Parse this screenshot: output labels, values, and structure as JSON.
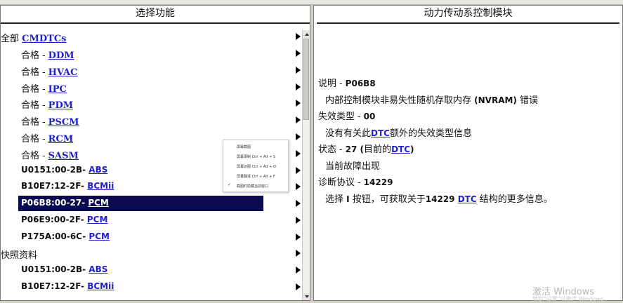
{
  "left_panel": {
    "title": "选择功能",
    "rows": [
      {
        "prefix": "全部 ",
        "link": "CMDTCs",
        "bold": false
      },
      {
        "prefix": "合格 - ",
        "link": "DDM",
        "bold": false
      },
      {
        "prefix": "合格 - ",
        "link": "HVAC",
        "bold": false
      },
      {
        "prefix": "合格 - ",
        "link": "IPC",
        "bold": false
      },
      {
        "prefix": "合格 - ",
        "link": "PDM",
        "bold": false
      },
      {
        "prefix": "合格 - ",
        "link": "PSCM",
        "bold": false
      },
      {
        "prefix": "合格 - ",
        "link": "RCM",
        "bold": false
      },
      {
        "prefix": "合格 - ",
        "link": "SASM",
        "bold": false
      },
      {
        "prefix": "U0151:00-2B- ",
        "link": "ABS",
        "bold": true
      },
      {
        "prefix": "B10E7:12-2F- ",
        "link": "BCMii",
        "bold": true
      },
      {
        "prefix": "P06B8:00-27- ",
        "link": "PCM",
        "bold": true,
        "selected": true
      },
      {
        "prefix": "P06E9:00-2F- ",
        "link": "PCM",
        "bold": true
      },
      {
        "prefix": "P175A:00-6C- ",
        "link": "PCM",
        "bold": true
      },
      {
        "prefix": "快照资料",
        "link": "",
        "bold": false
      },
      {
        "prefix": "U0151:00-2B- ",
        "link": "ABS",
        "bold": true
      },
      {
        "prefix": "B10E7:12-2F- ",
        "link": "BCMii",
        "bold": true
      }
    ]
  },
  "right_panel": {
    "title": "动力传动系控制模块",
    "lines": {
      "l1": {
        "a": "说明 - ",
        "b": "P06B8"
      },
      "l2": {
        "a": "内部控制模块非易失性随机存取内存 ",
        "b": "(NVRAM)",
        "c": " 错误"
      },
      "l3": {
        "a": "失效类型 - ",
        "b": "00"
      },
      "l4": {
        "a": "没有有关此",
        "link": "DTC",
        "c": "额外的失效类型信息"
      },
      "l5": {
        "a": "状态 - ",
        "b": "27 (",
        "c": "目前的",
        "link": "DTC",
        "d": ")"
      },
      "l6": {
        "a": "当前故障出现"
      },
      "l7": {
        "a": "诊断协议 - ",
        "b": "14229"
      },
      "l8": {
        "a": "选择 ",
        "b": "I",
        "c": " 按钮，可获取关于",
        "d": "14229 ",
        "link": "DTC",
        "e": " 结构的更多信息。"
      }
    }
  },
  "context_menu": {
    "items": [
      "屏幕截图",
      "屏幕录制 Ctrl + Alt + S",
      "屏幕识图 Ctrl + Alt + O",
      "屏幕翻译 Ctrl + Alt + F",
      "截图时隐藏当前窗口"
    ],
    "check": "✓"
  },
  "watermark": {
    "line1": "激活 Windows",
    "line2": "转到\"设置\"以激活 Windows。"
  }
}
